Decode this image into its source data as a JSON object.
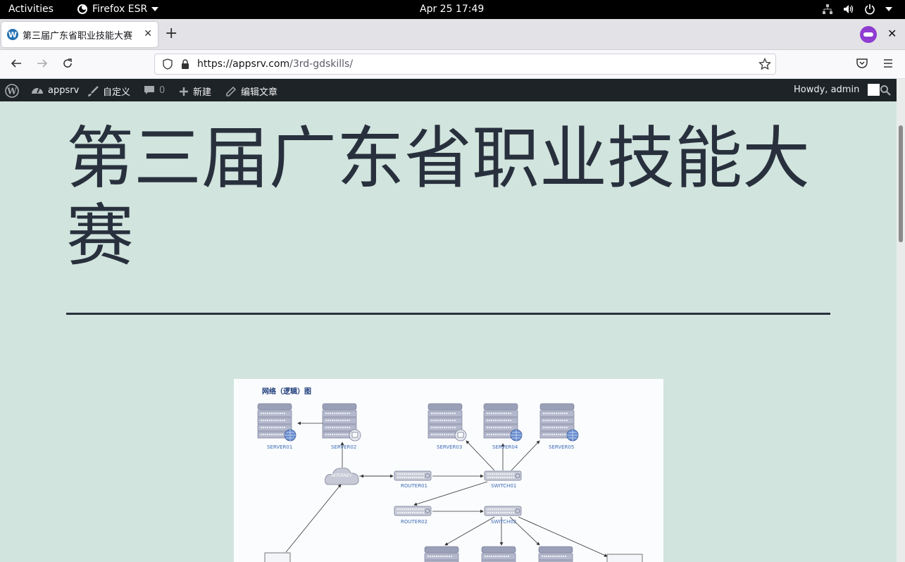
{
  "system_bar": {
    "activities": "Activities",
    "app_name": "Firefox ESR",
    "clock": "Apr 25  17:49"
  },
  "browser": {
    "tab_title": "第三届广东省职业技能大赛",
    "url_host": "https://appsrv.com",
    "url_path": "/3rd-gdskills/"
  },
  "wp_admin_bar": {
    "site_name": "appsrv",
    "customize": "自定义",
    "comments_count": "0",
    "new": "新建",
    "edit_post": "编辑文章",
    "howdy": "Howdy, admin"
  },
  "post": {
    "title": "第三届广东省职业技能大赛"
  },
  "diagram": {
    "title": "网络（逻辑）图",
    "nodes": {
      "server01": "SERVER01",
      "server02": "SERVER02",
      "server03": "SERVER03",
      "server04": "SERVER04",
      "server05": "SERVER05",
      "internet": "INTERNET",
      "router01": "ROUTER01",
      "router02": "ROUTER02",
      "switch01": "SWITCH01",
      "switch02": "SWITCH02"
    }
  },
  "colors": {
    "page_bg": "#d1e4dd",
    "title_text": "#28303d",
    "wp_bar_bg": "#1d2327",
    "diagram_label": "#3a6ab5"
  }
}
